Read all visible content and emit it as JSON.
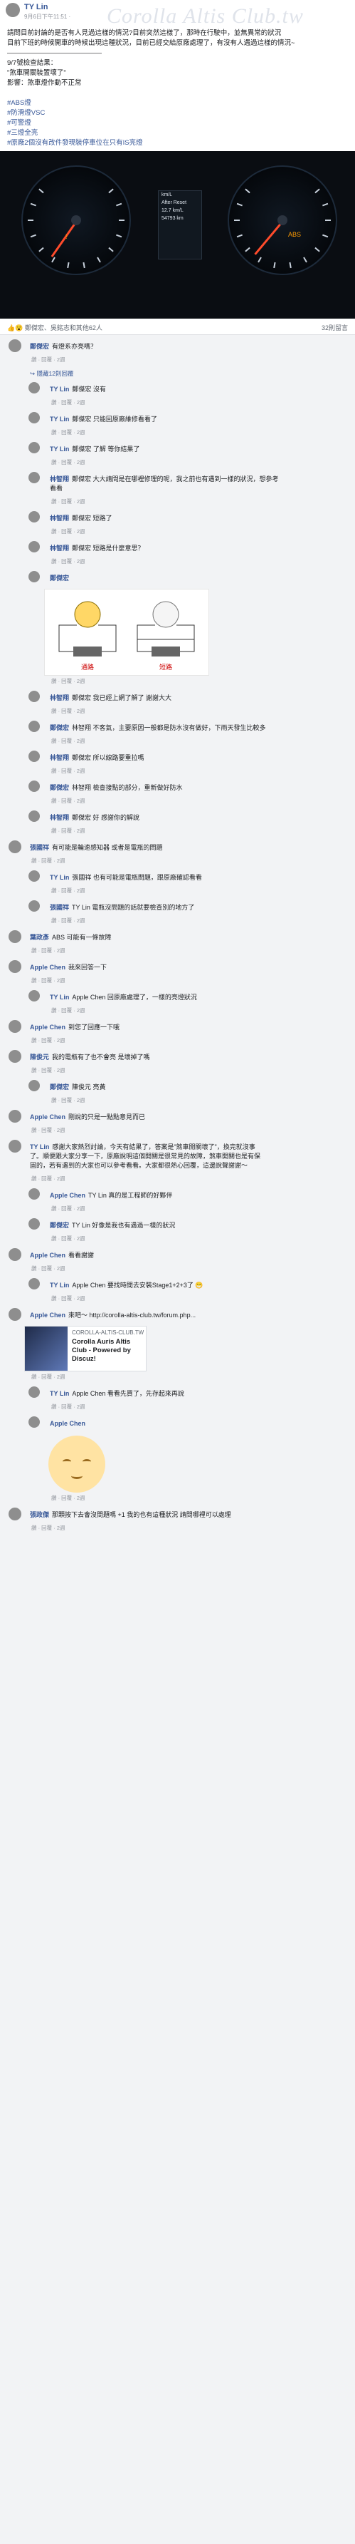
{
  "post": {
    "author": "TY Lin",
    "time": "9月6日下午11:51 · ",
    "watermark": "Corolla Altis Club.tw",
    "body_lines": [
      "請問目前討論的是否有人見過這樣的情況?目前突然這樣了，那時在行駛中，並無異常的狀況",
      "目前下班的時候開車的時候出現這種狀況，目前已經交給原廠處理了，有沒有人遇過這樣的情況~",
      "——————————————",
      "9/7號檢查結果：",
      "\"煞車開關裝置壞了\"",
      "影響：煞車燈作動不正常",
      "",
      "#ABS燈",
      "#防滑燈VSC",
      "#可警燈",
      "#三燈全亮",
      "#原廠2個沒有改件發現裝停車位在只有IS亮燈"
    ],
    "dashboard": {
      "panel_lines": [
        "km/L",
        "After Reset",
        "12.7 km/L",
        "54793 km"
      ],
      "left_warning": "!",
      "right_warning": "ABS"
    },
    "reactions_left": "👍😮 鄭傑宏、吳銘志和其他62人",
    "comments_count": "32則留言"
  },
  "comments": [
    {
      "id": "c1",
      "level": 0,
      "name": "鄭傑宏",
      "text": "有燈系亦亮嗎？",
      "meta": "讚 · 回覆 · 2週"
    },
    {
      "id": "hidden",
      "level": 1,
      "type": "more",
      "text": "↪ 隱藏12則回覆"
    },
    {
      "id": "c2",
      "level": 1,
      "name": "TY Lin",
      "text": "鄭傑宏 沒有",
      "meta": "讚 · 回覆 · 2週"
    },
    {
      "id": "c3",
      "level": 1,
      "name": "TY Lin",
      "text": "鄭傑宏 只能回原廠維修看看了",
      "meta": "讚 · 回覆 · 2週"
    },
    {
      "id": "c4",
      "level": 1,
      "name": "TY Lin",
      "text": "鄭傑宏 了解 等你結果了",
      "meta": "讚 · 回覆 · 2週"
    },
    {
      "id": "c5",
      "level": 1,
      "name": "林智翔",
      "text": "鄭傑宏 大大請問是在哪裡修理的呢，我之前也有遇到一樣的狀況，想參考看看",
      "meta": "讚 · 回覆 · 2週"
    },
    {
      "id": "c6",
      "level": 1,
      "name": "林智翔",
      "text": "鄭傑宏 短路了",
      "meta": "讚 · 回覆 · 2週"
    },
    {
      "id": "c7",
      "level": 1,
      "name": "林智翔",
      "text": "鄭傑宏 短路是什麼意思？",
      "meta": "讚 · 回覆 · 2週"
    },
    {
      "id": "c8",
      "level": 1,
      "name": "鄭傑宏",
      "type": "diagram",
      "text": "",
      "labels": [
        "通路",
        "短路"
      ],
      "meta": "讚 · 回覆 · 2週"
    },
    {
      "id": "c9",
      "level": 1,
      "name": "林智翔",
      "text": "鄭傑宏 我已經上網了解了 謝謝大大",
      "meta": "讚 · 回覆 · 2週"
    },
    {
      "id": "c10",
      "level": 1,
      "name": "鄭傑宏",
      "text": "林智翔 不客氣，主要原因一般都是防水沒有做好，下雨天發生比較多",
      "meta": "讚 · 回覆 · 2週"
    },
    {
      "id": "c11",
      "level": 1,
      "name": "林智翔",
      "text": "鄭傑宏 所以線路要重拉嗎",
      "meta": "讚 · 回覆 · 2週"
    },
    {
      "id": "c12",
      "level": 1,
      "name": "鄭傑宏",
      "text": "林智翔 檢查接點的部分，重新做好防水",
      "meta": "讚 · 回覆 · 2週"
    },
    {
      "id": "c13",
      "level": 1,
      "name": "林智翔",
      "text": "鄭傑宏 好 感謝你的解說",
      "meta": "讚 · 回覆 · 2週"
    },
    {
      "id": "c14",
      "level": 0,
      "name": "張國祥",
      "text": "有可能是輪速感知器 或者是電瓶的問題",
      "meta": "讚 · 回覆 · 2週"
    },
    {
      "id": "c15",
      "level": 1,
      "name": "TY Lin",
      "text": "張國祥 也有可能是電瓶問題，跟原廠確認看看",
      "meta": "讚 · 回覆 · 2週"
    },
    {
      "id": "c16",
      "level": 1,
      "name": "張國祥",
      "text": "TY Lin 電瓶沒問題的話就要檢查別的地方了",
      "meta": "讚 · 回覆 · 2週"
    },
    {
      "id": "c17",
      "level": 0,
      "name": "葉政彥",
      "text": "ABS 可能有一條故障",
      "meta": "讚 · 回覆 · 2週"
    },
    {
      "id": "c18",
      "level": 0,
      "name": "Apple Chen",
      "text": "我來回答一下",
      "meta": "讚 · 回覆 · 2週"
    },
    {
      "id": "c19",
      "level": 1,
      "name": "TY Lin",
      "text": "Apple Chen 回原廠處理了，一樣的亮燈狀況",
      "meta": "讚 · 回覆 · 2週"
    },
    {
      "id": "c20",
      "level": 0,
      "name": "Apple Chen",
      "text": "到您了回應一下哦",
      "meta": "讚 · 回覆 · 2週"
    },
    {
      "id": "c21",
      "level": 0,
      "name": "陳俊元",
      "text": "我的電瓶有了也不會亮 是壞掉了嗎",
      "meta": "讚 · 回覆 · 2週"
    },
    {
      "id": "c22",
      "level": 1,
      "name": "鄭傑宏",
      "text": "陳俊元 亮黃",
      "meta": "讚 · 回覆 · 2週"
    },
    {
      "id": "c23",
      "level": 0,
      "name": "Apple Chen",
      "text": "剛說的只是一點點意見而已",
      "meta": "讚 · 回覆 · 2週"
    },
    {
      "id": "c24",
      "level": 0,
      "name": "TY Lin",
      "text": "感謝大家熱烈討論，今天有結果了，答案是\"煞車開關壞了\"，換完就沒事了。順便跟大家分享一下，原廠說明這個開關是很常見的故障，煞車開關也是有保固的，若有遇到的大家也可以參考看看。大家都很熱心回覆，這邊說聲謝謝～",
      "meta": "讚 · 回覆 · 2週"
    },
    {
      "id": "c25",
      "level": 1,
      "name": "Apple Chen",
      "text": "TY Lin 真的是工程師的好夥伴",
      "meta": "讚 · 回覆 · 2週"
    },
    {
      "id": "c26",
      "level": 1,
      "name": "鄭傑宏",
      "text": "TY Lin 好像是我也有遇過一樣的狀況",
      "meta": "讚 · 回覆 · 2週"
    },
    {
      "id": "c27",
      "level": 0,
      "name": "Apple Chen",
      "text": "看看謝謝",
      "meta": "讚 · 回覆 · 2週"
    },
    {
      "id": "c28",
      "level": 1,
      "name": "TY Lin",
      "text": "Apple Chen 要找時間去安裝Stage1+2+3了 😁",
      "meta": "讚 · 回覆 · 2週"
    },
    {
      "id": "c29",
      "level": 0,
      "name": "Apple Chen",
      "type": "link",
      "text": "來吧～ http://corolla-altis-club.tw/forum.php...",
      "card_domain": "COROLLA-ALTIS-CLUB.TW",
      "card_title": "Corolla Auris Altis Club - Powered by Discuz!",
      "meta": "讚 · 回覆 · 2週"
    },
    {
      "id": "c30",
      "level": 1,
      "name": "TY Lin",
      "text": "Apple Chen 看看先買了，先存起來再說",
      "meta": "讚 · 回覆 · 2週"
    },
    {
      "id": "c31",
      "level": 1,
      "name": "Apple Chen",
      "type": "emoji",
      "text": "",
      "meta": "讚 · 回覆 · 2週"
    },
    {
      "id": "c32",
      "level": 0,
      "name": "張政傑",
      "text": "那顆按下去會沒問題嗎 +1 我的也有這種狀況 請問哪裡可以處理",
      "meta": "讚 · 回覆 · 2週"
    }
  ]
}
